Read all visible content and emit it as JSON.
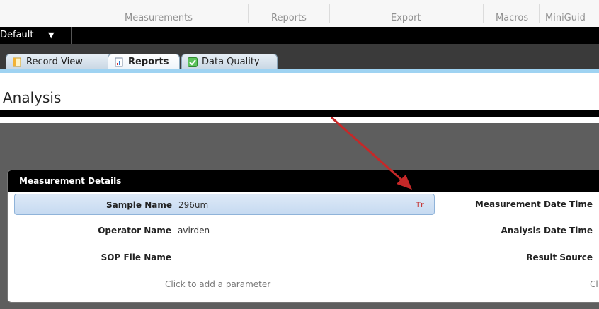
{
  "ribbon": {
    "groups": [
      "Measurements",
      "Reports",
      "Export",
      "Macros",
      "MiniGuid"
    ]
  },
  "profile": {
    "selected": "Default",
    "caret": "▼"
  },
  "tabs": [
    {
      "label": "Record View",
      "active": false
    },
    {
      "label": "Reports",
      "active": true
    },
    {
      "label": "Data Quality",
      "active": false
    }
  ],
  "page": {
    "title": "Analysis"
  },
  "details": {
    "header": "Measurement Details",
    "left": [
      {
        "label": "Sample Name",
        "value": "296um"
      },
      {
        "label": "Operator Name",
        "value": "avirden"
      },
      {
        "label": "SOP File Name",
        "value": ""
      }
    ],
    "right": [
      {
        "label": "Measurement Date Time"
      },
      {
        "label": "Analysis Date Time"
      },
      {
        "label": "Result Source"
      }
    ],
    "add_param": "Click to add a parameter",
    "add_param_right": "Cl",
    "text_format_icon": "Tr"
  },
  "colors": {
    "accent_tab_line": "#9fd3f2",
    "arrow": "#c62828",
    "selected_row": "#c6daf1"
  }
}
